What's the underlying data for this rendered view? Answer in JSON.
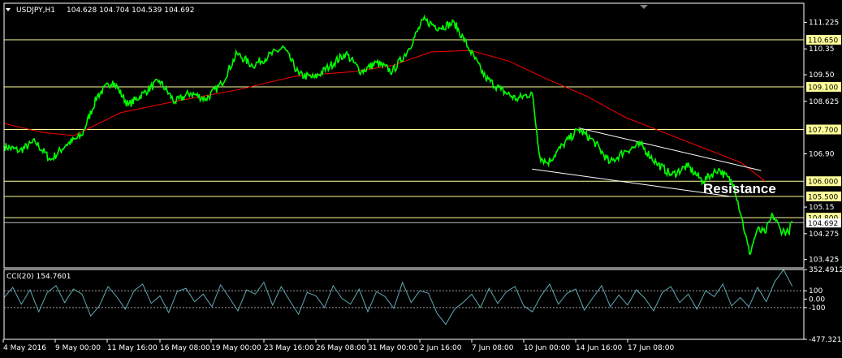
{
  "chart_data": {
    "type": "line",
    "symbol": "USDJPY,H1",
    "ohlc_text": "104.628 104.704 104.539 104.692",
    "colors": {
      "background": "#000000",
      "price": "#00ff00",
      "ma": "#ff0000",
      "hlines": "#ffff99",
      "trend": "#ffffff",
      "cci": "#5fa8b3"
    },
    "price_axis": {
      "ylim": [
        103.15,
        111.85
      ],
      "ticks": [
        111.225,
        110.35,
        109.5,
        108.625,
        106.9,
        105.15,
        104.275,
        103.425
      ]
    },
    "levels": [
      {
        "value": 110.65,
        "label": "110.650"
      },
      {
        "value": 109.1,
        "label": "109.100"
      },
      {
        "value": 107.7,
        "label": "107.700"
      },
      {
        "value": 106.0,
        "label": "106.000"
      },
      {
        "value": 105.5,
        "label": "105.500"
      },
      {
        "value": 104.8,
        "label": "104.800"
      }
    ],
    "annotation": "Resistance",
    "current_price": {
      "value": 104.692,
      "label": "104.692"
    },
    "x_labels": [
      "4 May 2016",
      "9 May 00:00",
      "11 May 16:00",
      "16 May 08:00",
      "19 May 00:00",
      "23 May 16:00",
      "26 May 08:00",
      "31 May 00:00",
      "2 Jun 16:00",
      "7 Jun 08:00",
      "10 Jun 00:00",
      "14 Jun 16:00",
      "17 Jun 08:00"
    ],
    "price_series": [
      {
        "x": 0,
        "y": 107.15
      },
      {
        "x": 4,
        "y": 107.0
      },
      {
        "x": 8,
        "y": 107.3
      },
      {
        "x": 12,
        "y": 106.7
      },
      {
        "x": 16,
        "y": 107.2
      },
      {
        "x": 20,
        "y": 107.5
      },
      {
        "x": 24,
        "y": 108.8
      },
      {
        "x": 28,
        "y": 109.3
      },
      {
        "x": 32,
        "y": 108.5
      },
      {
        "x": 36,
        "y": 108.9
      },
      {
        "x": 40,
        "y": 109.3
      },
      {
        "x": 44,
        "y": 108.6
      },
      {
        "x": 48,
        "y": 108.9
      },
      {
        "x": 52,
        "y": 108.7
      },
      {
        "x": 56,
        "y": 109.2
      },
      {
        "x": 60,
        "y": 110.2
      },
      {
        "x": 64,
        "y": 109.8
      },
      {
        "x": 68,
        "y": 110.1
      },
      {
        "x": 72,
        "y": 110.4
      },
      {
        "x": 76,
        "y": 109.5
      },
      {
        "x": 80,
        "y": 109.4
      },
      {
        "x": 84,
        "y": 109.8
      },
      {
        "x": 88,
        "y": 110.2
      },
      {
        "x": 92,
        "y": 109.6
      },
      {
        "x": 96,
        "y": 109.9
      },
      {
        "x": 100,
        "y": 109.6
      },
      {
        "x": 104,
        "y": 110.3
      },
      {
        "x": 108,
        "y": 111.3
      },
      {
        "x": 112,
        "y": 111.05
      },
      {
        "x": 116,
        "y": 111.2
      },
      {
        "x": 120,
        "y": 110.3
      },
      {
        "x": 124,
        "y": 109.4
      },
      {
        "x": 128,
        "y": 109.0
      },
      {
        "x": 132,
        "y": 108.7
      },
      {
        "x": 136,
        "y": 108.9
      },
      {
        "x": 138,
        "y": 106.8
      },
      {
        "x": 140,
        "y": 106.6
      },
      {
        "x": 144,
        "y": 107.2
      },
      {
        "x": 148,
        "y": 107.7
      },
      {
        "x": 152,
        "y": 107.3
      },
      {
        "x": 156,
        "y": 106.6
      },
      {
        "x": 160,
        "y": 107.0
      },
      {
        "x": 164,
        "y": 107.2
      },
      {
        "x": 168,
        "y": 106.6
      },
      {
        "x": 172,
        "y": 106.2
      },
      {
        "x": 176,
        "y": 106.5
      },
      {
        "x": 180,
        "y": 106.0
      },
      {
        "x": 184,
        "y": 106.4
      },
      {
        "x": 188,
        "y": 105.9
      },
      {
        "x": 190,
        "y": 104.8
      },
      {
        "x": 192,
        "y": 103.6
      },
      {
        "x": 194,
        "y": 104.4
      },
      {
        "x": 196,
        "y": 104.3
      },
      {
        "x": 198,
        "y": 104.9
      },
      {
        "x": 200,
        "y": 104.4
      },
      {
        "x": 202,
        "y": 104.3
      },
      {
        "x": 203,
        "y": 104.69
      }
    ],
    "ma_series": [
      {
        "x": 0,
        "y": 107.9
      },
      {
        "x": 10,
        "y": 107.6
      },
      {
        "x": 18,
        "y": 107.5
      },
      {
        "x": 30,
        "y": 108.25
      },
      {
        "x": 45,
        "y": 108.65
      },
      {
        "x": 60,
        "y": 109.0
      },
      {
        "x": 75,
        "y": 109.45
      },
      {
        "x": 90,
        "y": 109.6
      },
      {
        "x": 100,
        "y": 109.8
      },
      {
        "x": 110,
        "y": 110.25
      },
      {
        "x": 120,
        "y": 110.3
      },
      {
        "x": 130,
        "y": 109.95
      },
      {
        "x": 140,
        "y": 109.35
      },
      {
        "x": 150,
        "y": 108.8
      },
      {
        "x": 160,
        "y": 108.1
      },
      {
        "x": 170,
        "y": 107.6
      },
      {
        "x": 180,
        "y": 107.1
      },
      {
        "x": 190,
        "y": 106.6
      },
      {
        "x": 196,
        "y": 106.0
      }
    ],
    "trendlines": [
      {
        "from": {
          "x": 148,
          "y": 107.75
        },
        "to": {
          "x": 195,
          "y": 106.35
        }
      },
      {
        "from": {
          "x": 136,
          "y": 106.4
        },
        "to": {
          "x": 187,
          "y": 105.5
        }
      }
    ],
    "cci": {
      "label": "CCI(20) 154.7601",
      "ylim": [
        -477.3213,
        352.4912
      ],
      "tick_labels": [
        "352.4912",
        "100",
        "0.00",
        "-100",
        "-477.3213"
      ],
      "levels": [
        100,
        -100
      ],
      "values": [
        20,
        140,
        -60,
        110,
        -150,
        80,
        160,
        -40,
        120,
        60,
        -200,
        -80,
        150,
        30,
        -120,
        100,
        180,
        -50,
        40,
        -160,
        90,
        130,
        -30,
        60,
        -90,
        170,
        20,
        -140,
        110,
        60,
        200,
        -70,
        150,
        -20,
        -180,
        80,
        40,
        -100,
        160,
        10,
        -60,
        120,
        -150,
        90,
        30,
        -110,
        200,
        -40,
        100,
        70,
        -170,
        -300,
        -120,
        -40,
        60,
        -100,
        130,
        -50,
        90,
        150,
        -80,
        -150,
        40,
        180,
        -60,
        70,
        120,
        -130,
        20,
        160,
        -90,
        50,
        -70,
        110,
        10,
        -140,
        80,
        150,
        -40,
        60,
        -120,
        100,
        30,
        180,
        -80,
        20,
        -90,
        140,
        -30,
        210,
        350,
        155
      ]
    }
  }
}
